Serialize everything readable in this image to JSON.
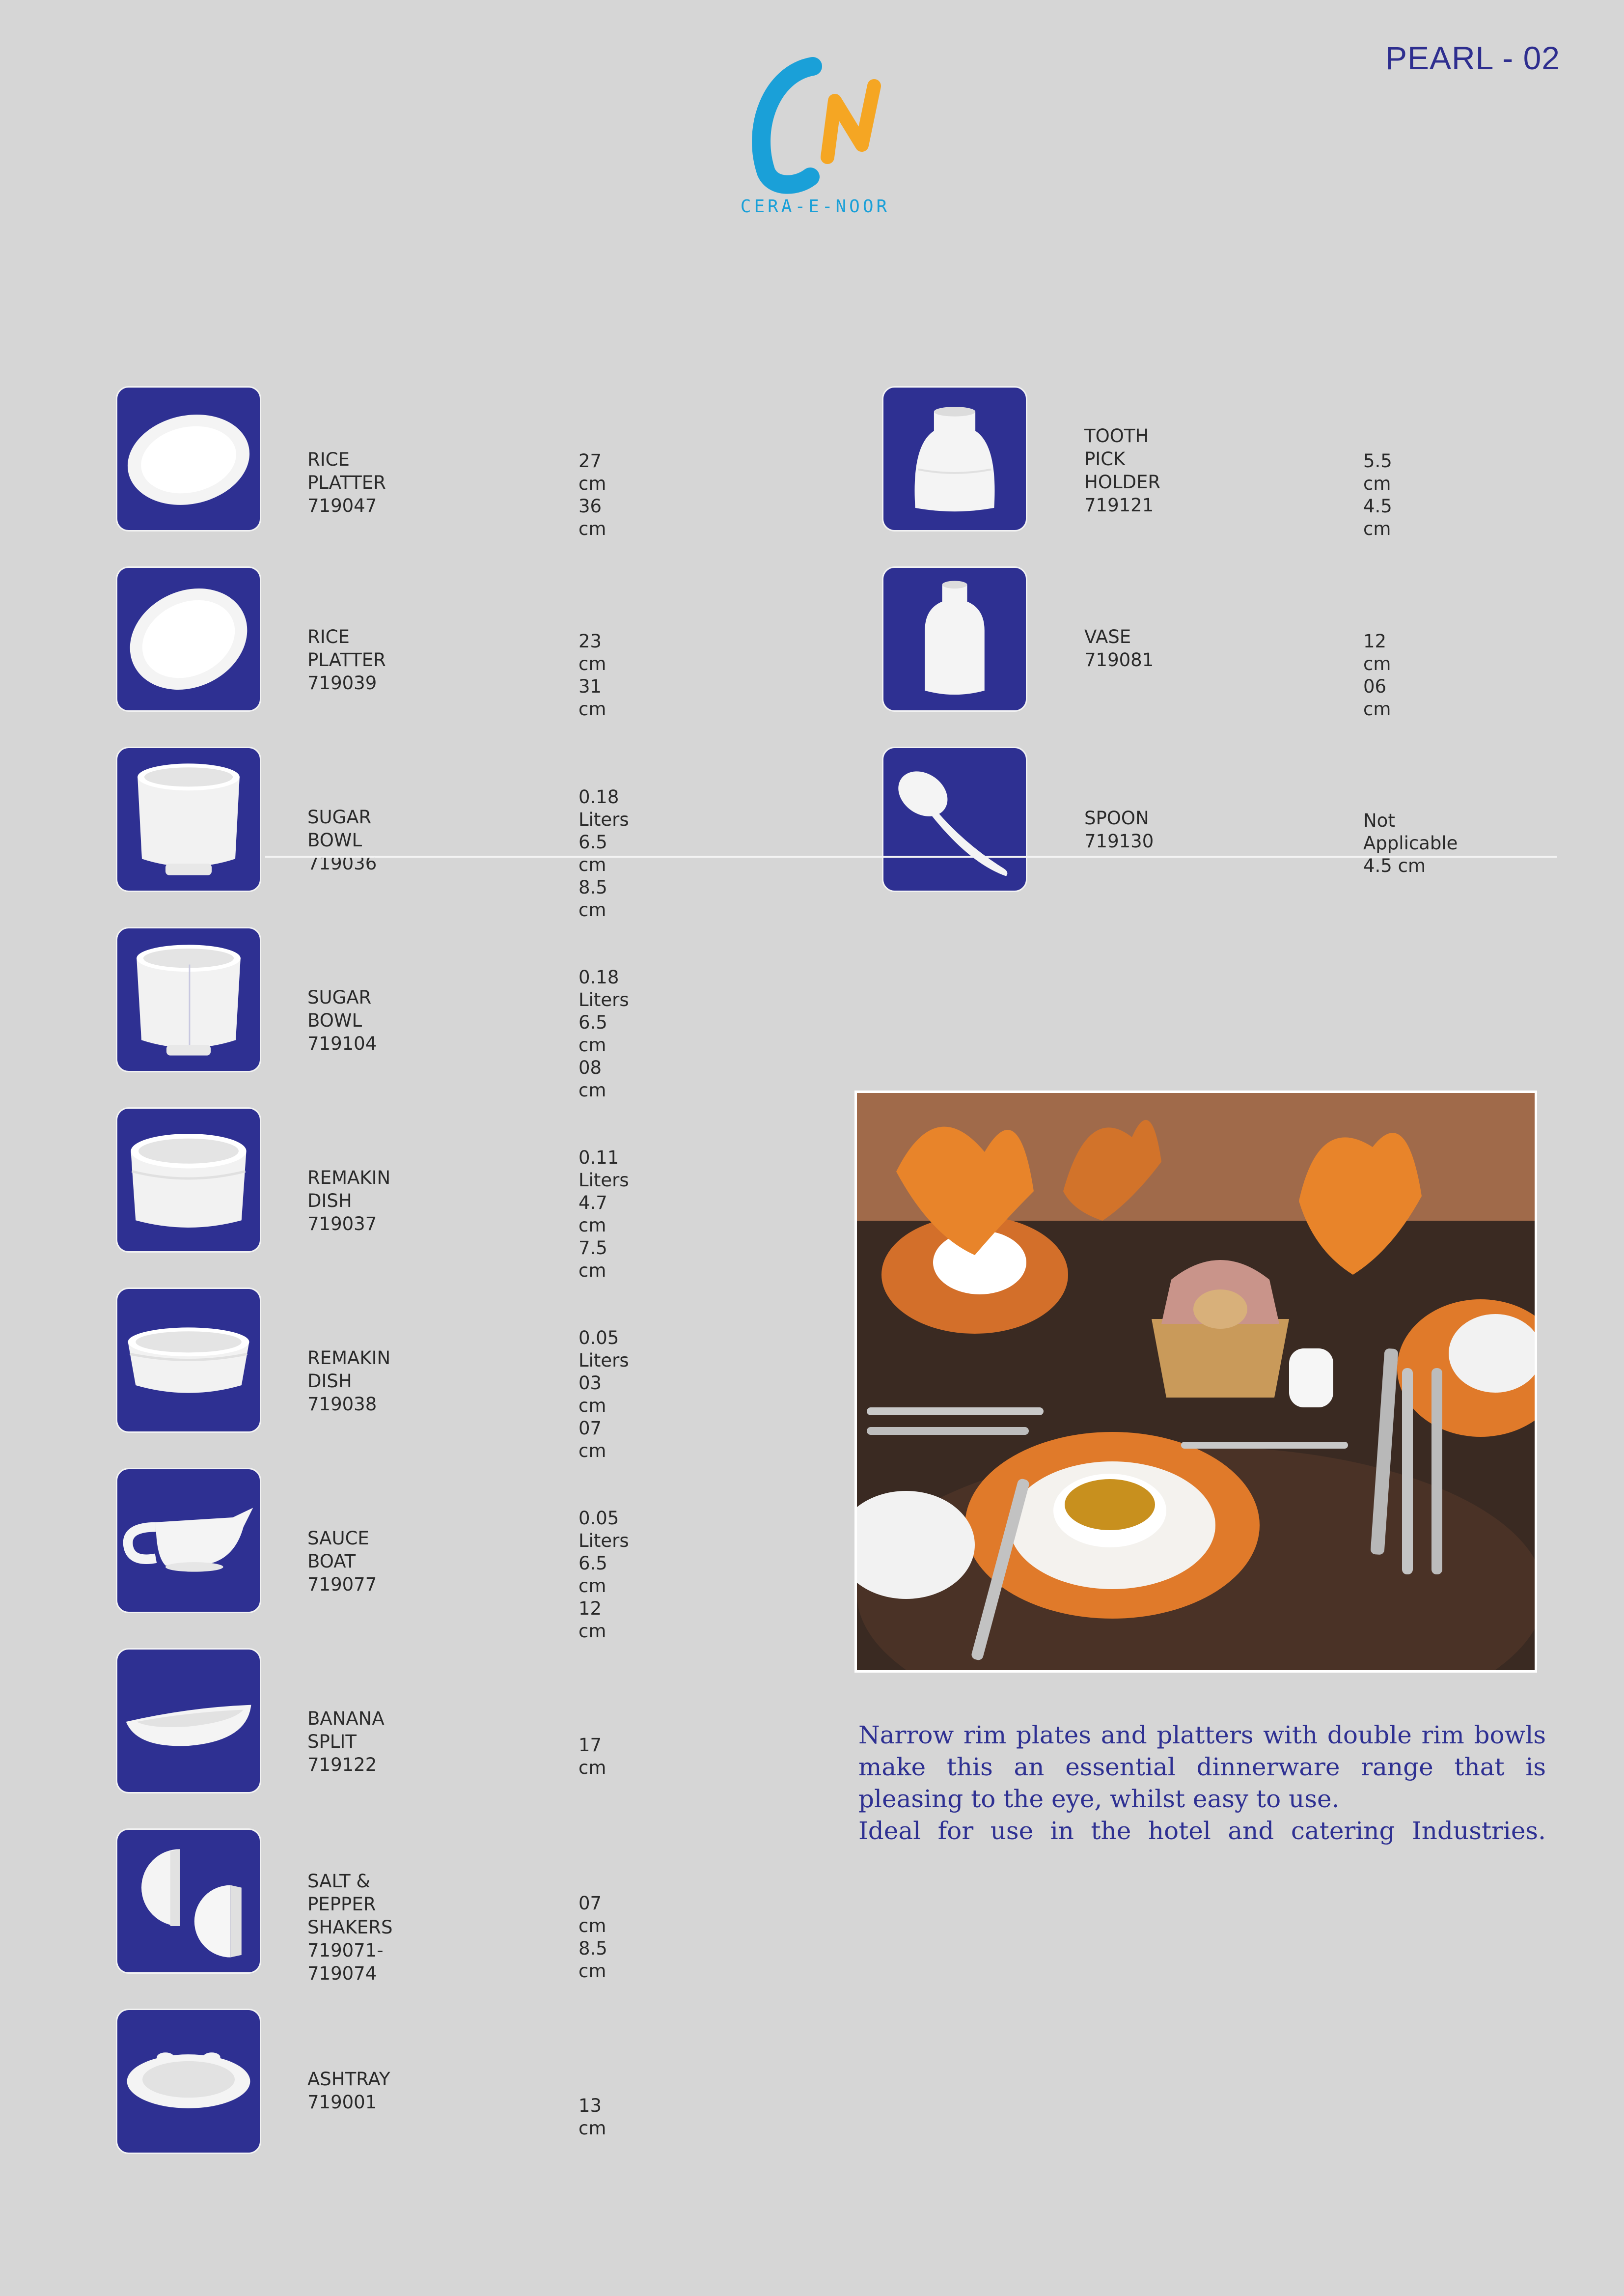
{
  "header": {
    "page_code": "PEARL - 02",
    "brand_name": "CERA-E-NOOR",
    "logo_letters": "CN"
  },
  "left_items": [
    {
      "name": "RICE PLATTER\n719047",
      "dims": "27 cm\n36 cm",
      "icon": "oval-platter-icon"
    },
    {
      "name": "RICE PLATTER\n719039",
      "dims": "23 cm\n31 cm",
      "icon": "oval-platter-icon"
    },
    {
      "name": "SUGAR BOWL\n719036",
      "dims": "0.18 Liters\n6.5 cm\n8.5 cm",
      "icon": "sugar-bowl-icon"
    },
    {
      "name": "SUGAR BOWL\n719104",
      "dims": "0.18 Liters\n6.5 cm\n08 cm",
      "icon": "sugar-bowl-icon"
    },
    {
      "name": "REMAKIN DISH\n719037",
      "dims": "0.11 Liters\n4.7 cm\n7.5 cm",
      "icon": "ramekin-icon"
    },
    {
      "name": "REMAKIN DISH\n719038",
      "dims": "0.05 Liters\n03 cm\n07 cm",
      "icon": "ramekin-icon"
    },
    {
      "name": "SAUCE BOAT\n719077",
      "dims": "0.05 Liters\n6.5 cm\n12 cm",
      "icon": "sauce-boat-icon"
    },
    {
      "name": "BANANA SPLIT\n719122",
      "dims": "17 cm",
      "icon": "banana-split-icon"
    },
    {
      "name": "SALT & PEPPER\nSHAKERS\n719071-719074",
      "dims": "07 cm\n8.5 cm",
      "icon": "salt-pepper-shakers-icon"
    },
    {
      "name": "ASHTRAY\n719001",
      "dims": "13 cm",
      "icon": "ashtray-icon"
    }
  ],
  "right_items": [
    {
      "name": "TOOTH PICK\nHOLDER\n719121",
      "dims": "5.5 cm\n4.5 cm",
      "icon": "toothpick-holder-icon"
    },
    {
      "name": "VASE\n719081",
      "dims": "12 cm\n06 cm",
      "icon": "vase-icon"
    },
    {
      "name": "SPOON\n719130",
      "dims": "Not Applicable\n4.5 cm",
      "icon": "spoon-icon"
    }
  ],
  "description": [
    "Narrow rim plates and platters with double rim bowls",
    "make this an essential dinnerware range that is",
    "pleasing to the eye, whilst easy to use.",
    "Ideal for use in the  hotel and  catering Industries."
  ],
  "colors": {
    "thumb_bg": "#2e3092",
    "accent": "#2e3092",
    "logo_blue": "#1aa0d8",
    "logo_orange": "#f5a623",
    "background": "#d6d6d6"
  }
}
